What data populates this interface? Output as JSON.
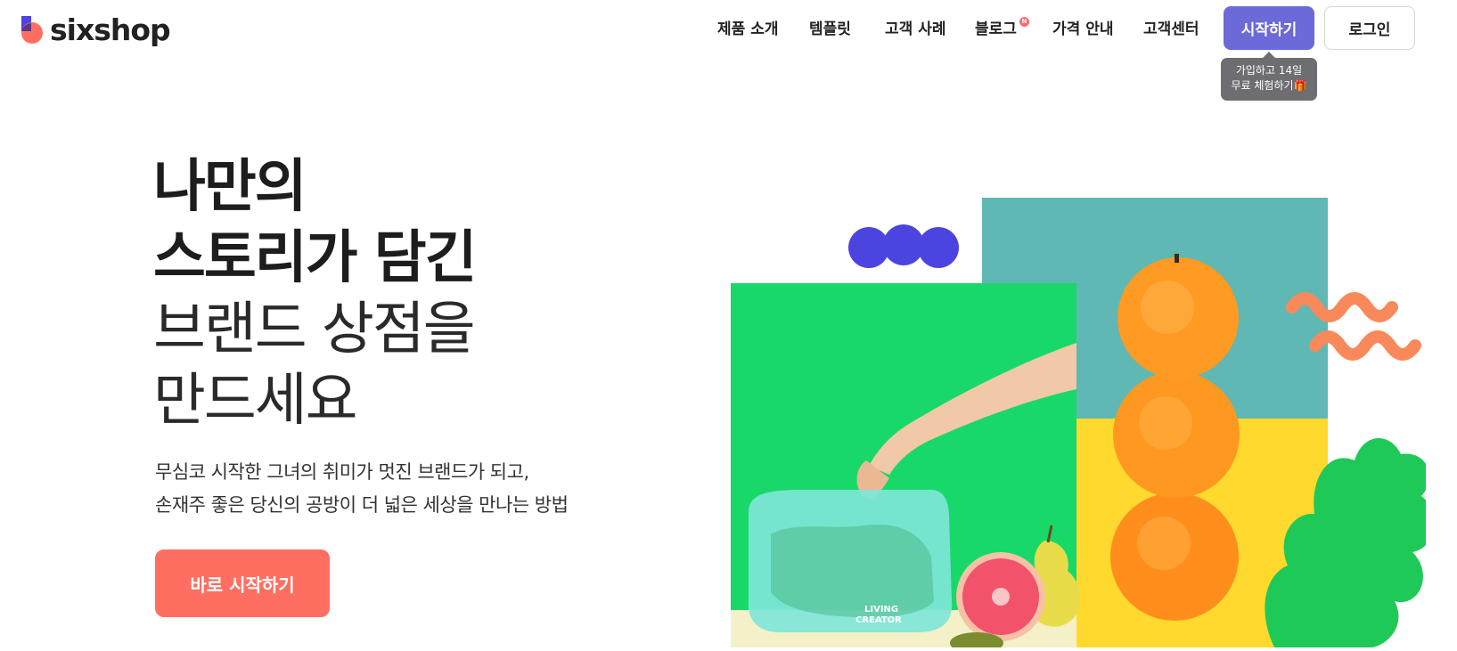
{
  "brand": {
    "name": "sixshop",
    "logo_icon": "sixshop-logo-icon"
  },
  "nav": {
    "items": [
      {
        "label": "제품 소개"
      },
      {
        "label": "템플릿"
      },
      {
        "label": "고객 사례"
      },
      {
        "label": "블로그",
        "badge": "N"
      },
      {
        "label": "가격 안내"
      },
      {
        "label": "고객센터"
      }
    ],
    "start_label": "시작하기",
    "login_label": "로그인",
    "tooltip_line1": "가입하고 14일",
    "tooltip_line2": "무료 체험하기🎁"
  },
  "hero": {
    "line1": "나만의",
    "line2": "스토리가 담긴",
    "line3": "브랜드 상점을",
    "line4": "만드세요",
    "sub1": "무심코 시작한 그녀의 취미가 멋진 브랜드가 되고,",
    "sub2": "손재주 좋은 당신의 공방이 더 넓은 세상을 만나는 방법",
    "cta_label": "바로 시작하기",
    "product_label_1": "LIVING",
    "product_label_2": "CREATOR"
  },
  "colors": {
    "accent_purple": "#6b6ad8",
    "cta_coral": "#ff6f61",
    "green_panel": "#19d86a",
    "teal_panel": "#5fb8b4",
    "yellow_panel": "#ffd92e",
    "blue_blob": "#4b44de",
    "orange_wave": "#f9895a",
    "leaf_green": "#1fc957"
  }
}
